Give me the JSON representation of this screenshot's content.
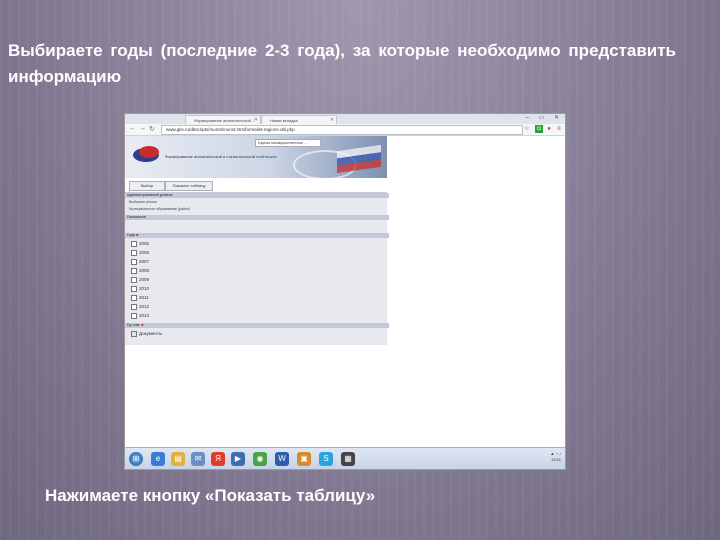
{
  "slide": {
    "heading": "Выбираете годы (последние 2-3 года), за которые необходимо представить информацию",
    "caption": "Нажимаете кнопку «Показать таблицу»"
  },
  "browser": {
    "tabs": [
      {
        "label": "Формирование аналитической ..."
      },
      {
        "label": "Новая вкладка"
      }
    ],
    "address": "www.gks.ru/dbscripts/munst/munst.htm/formalist-regions-obl.php",
    "window_controls": "– ▭ ✕"
  },
  "page": {
    "banner_top": "Единая межведомственная ...",
    "banner_title": "Формирование аналитической и статистической отчётности",
    "buttons": {
      "select": "Выбор",
      "show_table": "Показать таблицу"
    },
    "sections": {
      "region": "Административный уровень",
      "period": "Показатели",
      "years": "Годы",
      "unit": "Ед. изм."
    },
    "lines": [
      "Выберите регион",
      "Муниципальное образование (район)"
    ],
    "years": [
      "2005",
      "2006",
      "2007",
      "2008",
      "2009",
      "2010",
      "2011",
      "2012",
      "2013"
    ],
    "unit_option": "Документы"
  },
  "taskbar": {
    "icons": [
      "windows-start",
      "ie",
      "explorer",
      "mail",
      "yandex",
      "media",
      "chrome",
      "docs",
      "files",
      "skype",
      "calc"
    ],
    "clock": "13:51"
  }
}
